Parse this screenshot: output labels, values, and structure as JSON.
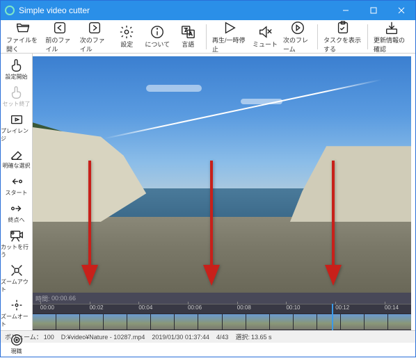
{
  "window": {
    "title": "Simple video cutter"
  },
  "toolbar": {
    "open": "ファイルを開く",
    "prev": "前のファイル",
    "next": "次のファイル",
    "settings": "設定",
    "about": "について",
    "lang": "言語",
    "play": "再生/一時停止",
    "mute": "ミュート",
    "nextframe": "次のフレーム",
    "tasks": "タスクを表示する",
    "update": "更新情報の確認"
  },
  "sidebar": {
    "setstart": "設定開始",
    "setend": "セット終了",
    "playrange": "プレイレンジ",
    "clearsel": "明確な選択",
    "start": "スタート",
    "endpoint": "終点へ",
    "docut": "カットを行う",
    "zoomout": "ズームアウト",
    "zoomauto": "ズームオート",
    "current": "現職"
  },
  "timeline": {
    "time_label": "時間:",
    "time_value": "00:00.66",
    "ticks": [
      "00:00",
      "00:02",
      "00:04",
      "00:06",
      "00:08",
      "00:10",
      "00:12",
      "00:14"
    ]
  },
  "status": {
    "volume_label": "ボリューム：",
    "volume_value": "100",
    "path": "D:¥video¥Nature - 10287.mp4",
    "datetime": "2019/01/30 01:37:44",
    "frames": "4/43",
    "sel_label": "選択:",
    "sel_value": "13.65 s"
  }
}
